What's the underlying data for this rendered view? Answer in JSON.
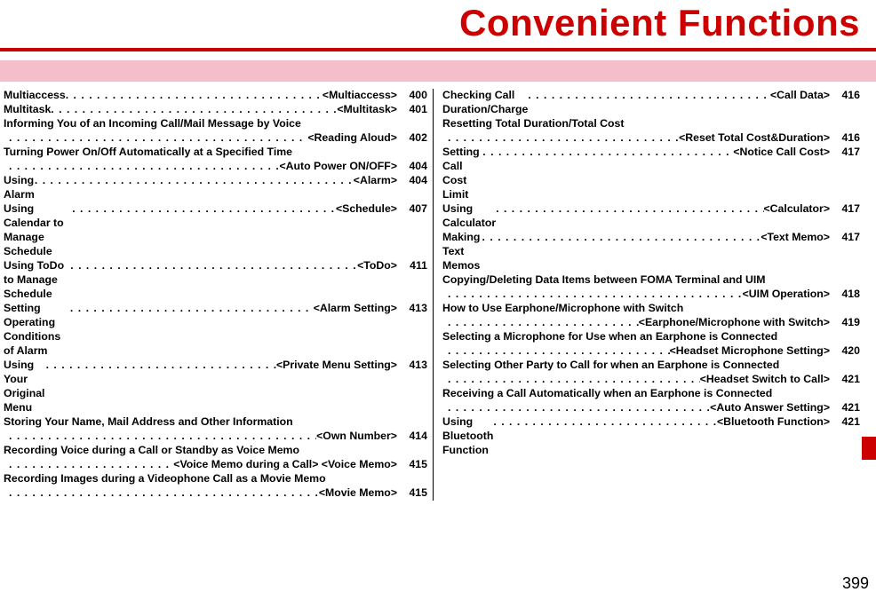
{
  "title": "Convenient Functions",
  "page_number": "399",
  "columns": [
    [
      {
        "text": "Multiaccess",
        "ref": "<Multiaccess>",
        "page": "400"
      },
      {
        "text": "Multitask",
        "ref": "<Multitask>",
        "page": "401"
      },
      {
        "text": "Informing You of an Incoming Call/Mail Message by Voice",
        "ref": "",
        "page": "",
        "wrap": true
      },
      {
        "text": "",
        "ref": "<Reading Aloud>",
        "page": "402",
        "indent": true
      },
      {
        "text": "Turning Power On/Off Automatically at a Specified Time",
        "ref": "",
        "page": "",
        "wrap": true
      },
      {
        "text": "",
        "ref": "<Auto Power ON/OFF>",
        "page": "404",
        "indent": true
      },
      {
        "text": "Using Alarm",
        "ref": "<Alarm>",
        "page": "404"
      },
      {
        "text": "Using Calendar to Manage Schedule",
        "ref": "<Schedule>",
        "page": "407"
      },
      {
        "text": "Using ToDo to Manage Schedule",
        "ref": "<ToDo>",
        "page": "411"
      },
      {
        "text": "Setting Operating Conditions of Alarm",
        "ref": "<Alarm Setting>",
        "page": "413"
      },
      {
        "text": "Using Your Original Menu",
        "ref": "<Private Menu Setting>",
        "page": "413"
      },
      {
        "text": "Storing Your Name, Mail Address and Other Information",
        "ref": "",
        "page": "",
        "wrap": true
      },
      {
        "text": "",
        "ref": "<Own Number>",
        "page": "414",
        "indent": true
      },
      {
        "text": "Recording Voice during a Call or Standby as Voice Memo",
        "ref": "",
        "page": "",
        "wrap": true
      },
      {
        "text": "",
        "ref": "<Voice Memo during a Call> <Voice Memo>",
        "page": "415",
        "indent": true
      },
      {
        "text": "Recording Images during a Videophone Call as a Movie Memo",
        "ref": "",
        "page": "",
        "wrap": true
      },
      {
        "text": "",
        "ref": "<Movie Memo>",
        "page": "415",
        "indent": true
      }
    ],
    [
      {
        "text": "Checking Call Duration/Charge",
        "ref": "<Call Data>",
        "page": "416"
      },
      {
        "text": "Resetting Total Duration/Total Cost",
        "ref": "",
        "page": "",
        "wrap": true
      },
      {
        "text": "",
        "ref": "<Reset Total Cost&Duration>",
        "page": "416",
        "indent": true
      },
      {
        "text": "Setting Call Cost Limit",
        "ref": "<Notice Call Cost>",
        "page": "417"
      },
      {
        "text": "Using Calculator",
        "ref": "<Calculator>",
        "page": "417"
      },
      {
        "text": "Making Text Memos",
        "ref": "<Text Memo>",
        "page": "417"
      },
      {
        "text": "Copying/Deleting Data Items between FOMA Terminal and UIM",
        "ref": "",
        "page": "",
        "wrap": true
      },
      {
        "text": "",
        "ref": "<UIM Operation>",
        "page": "418",
        "indent": true
      },
      {
        "text": "How to Use Earphone/Microphone with Switch",
        "ref": "",
        "page": "",
        "wrap": true
      },
      {
        "text": "",
        "ref": "<Earphone/Microphone with Switch>",
        "page": "419",
        "indent": true
      },
      {
        "text": "Selecting a Microphone for Use when an Earphone is Connected",
        "ref": "",
        "page": "",
        "wrap": true
      },
      {
        "text": "",
        "ref": "<Headset Microphone Setting>",
        "page": "420",
        "indent": true
      },
      {
        "text": "Selecting Other Party to Call for when an Earphone is Connected",
        "ref": "",
        "page": "",
        "wrap": true
      },
      {
        "text": "",
        "ref": "<Headset Switch to Call>",
        "page": "421",
        "indent": true
      },
      {
        "text": "Receiving a Call Automatically when an Earphone is Connected",
        "ref": "",
        "page": "",
        "wrap": true
      },
      {
        "text": "",
        "ref": "<Auto Answer Setting>",
        "page": "421",
        "indent": true
      },
      {
        "text": "Using Bluetooth Function",
        "ref": "<Bluetooth Function>",
        "page": "421"
      }
    ]
  ]
}
